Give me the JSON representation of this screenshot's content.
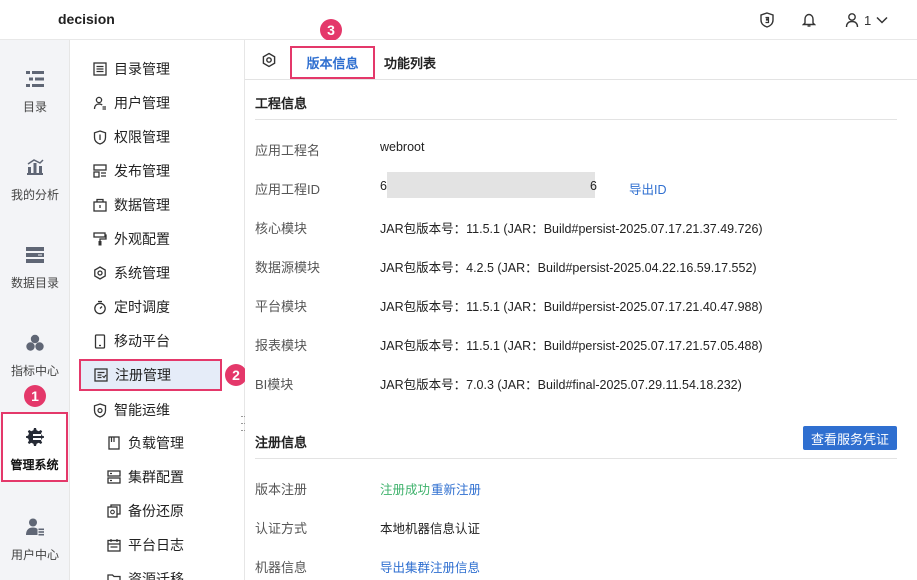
{
  "app": {
    "brand": "decision"
  },
  "header": {
    "user_name": "1"
  },
  "rail": {
    "items": [
      {
        "label": "目录",
        "icon": "catalog-icon"
      },
      {
        "label": "我的分析",
        "icon": "analysis-icon"
      },
      {
        "label": "数据目录",
        "icon": "data-catalog-icon"
      },
      {
        "label": "指标中心",
        "icon": "metrics-icon"
      },
      {
        "label": "管理系统",
        "icon": "manage-system-icon",
        "active": true
      },
      {
        "label": "用户中心",
        "icon": "user-center-icon"
      }
    ]
  },
  "nav": {
    "items": [
      {
        "label": "目录管理",
        "icon": "list-icon"
      },
      {
        "label": "用户管理",
        "icon": "user-icon"
      },
      {
        "label": "权限管理",
        "icon": "shield-icon"
      },
      {
        "label": "发布管理",
        "icon": "publish-icon"
      },
      {
        "label": "数据管理",
        "icon": "database-icon"
      },
      {
        "label": "外观配置",
        "icon": "brush-icon"
      },
      {
        "label": "系统管理",
        "icon": "gear-icon"
      },
      {
        "label": "定时调度",
        "icon": "timer-icon"
      },
      {
        "label": "移动平台",
        "icon": "mobile-icon"
      },
      {
        "label": "注册管理",
        "icon": "register-icon",
        "active": true
      },
      {
        "label": "智能运维",
        "icon": "ops-icon",
        "expanded": true
      },
      {
        "label": "负载管理",
        "icon": "load-icon",
        "sub": true
      },
      {
        "label": "集群配置",
        "icon": "cluster-icon",
        "sub": true
      },
      {
        "label": "备份还原",
        "icon": "backup-icon",
        "sub": true
      },
      {
        "label": "平台日志",
        "icon": "log-icon",
        "sub": true
      },
      {
        "label": "资源迁移",
        "icon": "migrate-icon",
        "sub": true
      }
    ]
  },
  "badges": {
    "rail": "1",
    "nav": "2",
    "tab": "3"
  },
  "tabs": {
    "version": "版本信息",
    "features": "功能列表"
  },
  "project": {
    "title": "工程信息",
    "rows": [
      {
        "label": "应用工程名",
        "value": "webroot"
      },
      {
        "label": "应用工程ID",
        "value_prefix": "6",
        "value_suffix": "6",
        "link": "导出ID"
      },
      {
        "label": "核心模块",
        "value": "JAR包版本号：11.5.1 (JAR：Build#persist-2025.07.17.21.37.49.726)"
      },
      {
        "label": "数据源模块",
        "value": "JAR包版本号：4.2.5 (JAR：Build#persist-2025.04.22.16.59.17.552)"
      },
      {
        "label": "平台模块",
        "value": "JAR包版本号：11.5.1 (JAR：Build#persist-2025.07.17.21.40.47.988)"
      },
      {
        "label": "报表模块",
        "value": "JAR包版本号：11.5.1 (JAR：Build#persist-2025.07.17.21.57.05.488)"
      },
      {
        "label": "BI模块",
        "value": "JAR包版本号：7.0.3 (JAR：Build#final-2025.07.29.11.54.18.232)"
      }
    ]
  },
  "registration": {
    "title": "注册信息",
    "view_button": "查看服务凭证",
    "rows": [
      {
        "label": "版本注册",
        "status": "注册成功",
        "link": "重新注册"
      },
      {
        "label": "认证方式",
        "value": "本地机器信息认证"
      },
      {
        "label": "机器信息",
        "link": "导出集群注册信息"
      }
    ]
  },
  "colors": {
    "accent": "#2f6fd0",
    "highlight": "#e4386a",
    "success": "#3fb26c"
  }
}
